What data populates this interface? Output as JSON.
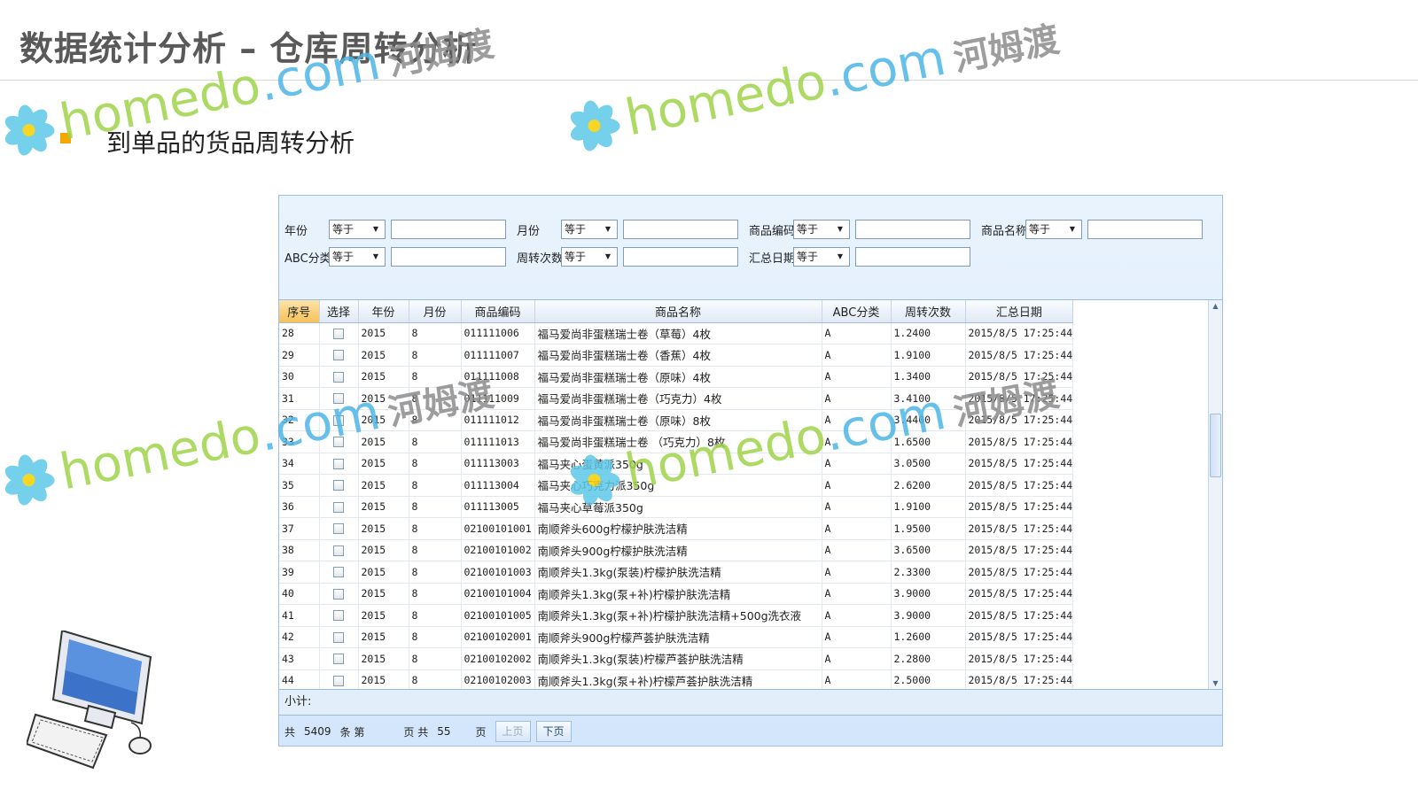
{
  "slide": {
    "title": "数据统计分析 – 仓库周转分析",
    "bullet": "到单品的货品周转分析"
  },
  "watermark": {
    "home": "home",
    "do": "do",
    "com": ".com",
    "cn": "河姆渡"
  },
  "filters": {
    "op_label": "等于",
    "row1": [
      {
        "label": "年份"
      },
      {
        "label": "月份"
      },
      {
        "label": "商品编码"
      },
      {
        "label": "商品名称"
      }
    ],
    "row2": [
      {
        "label": "ABC分类"
      },
      {
        "label": "周转次数"
      },
      {
        "label": "汇总日期"
      }
    ]
  },
  "grid": {
    "columns": [
      "序号",
      "选择",
      "年份",
      "月份",
      "商品编码",
      "商品名称",
      "ABC分类",
      "周转次数",
      "汇总日期"
    ],
    "rows": [
      [
        "28",
        "2015",
        "8",
        "011111006",
        "福马爱尚非蛋糕瑞士卷（草莓）4枚",
        "A",
        "1.2400",
        "2015/8/5 17:25:44"
      ],
      [
        "29",
        "2015",
        "8",
        "011111007",
        "福马爱尚非蛋糕瑞士卷（香蕉）4枚",
        "A",
        "1.9100",
        "2015/8/5 17:25:44"
      ],
      [
        "30",
        "2015",
        "8",
        "011111008",
        "福马爱尚非蛋糕瑞士卷（原味）4枚",
        "A",
        "1.3400",
        "2015/8/5 17:25:44"
      ],
      [
        "31",
        "2015",
        "8",
        "011111009",
        "福马爱尚非蛋糕瑞士卷（巧克力）4枚",
        "A",
        "3.4100",
        "2015/8/5 17:25:44"
      ],
      [
        "32",
        "2015",
        "8",
        "011111012",
        "福马爱尚非蛋糕瑞士卷（原味）8枚",
        "A",
        "3.4400",
        "2015/8/5 17:25:44"
      ],
      [
        "33",
        "2015",
        "8",
        "011111013",
        "福马爱尚非蛋糕瑞士卷 （巧克力）8枚",
        "A",
        "1.6500",
        "2015/8/5 17:25:44"
      ],
      [
        "34",
        "2015",
        "8",
        "011113003",
        "福马夹心蛋黄派350g",
        "A",
        "3.0500",
        "2015/8/5 17:25:44"
      ],
      [
        "35",
        "2015",
        "8",
        "011113004",
        "福马夹心巧克力派350g",
        "A",
        "2.6200",
        "2015/8/5 17:25:44"
      ],
      [
        "36",
        "2015",
        "8",
        "011113005",
        "福马夹心草莓派350g",
        "A",
        "1.9100",
        "2015/8/5 17:25:44"
      ],
      [
        "37",
        "2015",
        "8",
        "02100101001",
        "南顺斧头600g柠檬护肤洗洁精",
        "A",
        "1.9500",
        "2015/8/5 17:25:44"
      ],
      [
        "38",
        "2015",
        "8",
        "02100101002",
        "南顺斧头900g柠檬护肤洗洁精",
        "A",
        "3.6500",
        "2015/8/5 17:25:44"
      ],
      [
        "39",
        "2015",
        "8",
        "02100101003",
        "南顺斧头1.3kg(泵装)柠檬护肤洗洁精",
        "A",
        "2.3300",
        "2015/8/5 17:25:44"
      ],
      [
        "40",
        "2015",
        "8",
        "02100101004",
        "南顺斧头1.3kg(泵+补)柠檬护肤洗洁精",
        "A",
        "3.9000",
        "2015/8/5 17:25:44"
      ],
      [
        "41",
        "2015",
        "8",
        "02100101005",
        "南顺斧头1.3kg(泵+补)柠檬护肤洗洁精+500g洗衣液",
        "A",
        "3.9000",
        "2015/8/5 17:25:44"
      ],
      [
        "42",
        "2015",
        "8",
        "02100102001",
        "南顺斧头900g柠檬芦荟护肤洗洁精",
        "A",
        "1.2600",
        "2015/8/5 17:25:44"
      ],
      [
        "43",
        "2015",
        "8",
        "02100102002",
        "南顺斧头1.3kg(泵装)柠檬芦荟护肤洗洁精",
        "A",
        "2.2800",
        "2015/8/5 17:25:44"
      ],
      [
        "44",
        "2015",
        "8",
        "02100102003",
        "南顺斧头1.3kg(泵+补)柠檬芦荟护肤洗洁精",
        "A",
        "2.5000",
        "2015/8/5 17:25:44"
      ]
    ],
    "subtotal_label": "小计:"
  },
  "pager": {
    "total_prefix": "共",
    "total_count": "5409",
    "page_prefix": "条 第",
    "page_mid": "页 共",
    "page_total": "55",
    "page_suffix": "页",
    "prev": "上页",
    "next": "下页"
  },
  "colors": {
    "accent_bullet": "#f5a800",
    "sorted_header": "#f6c15a",
    "panel_bg": "#d3e6fb"
  }
}
